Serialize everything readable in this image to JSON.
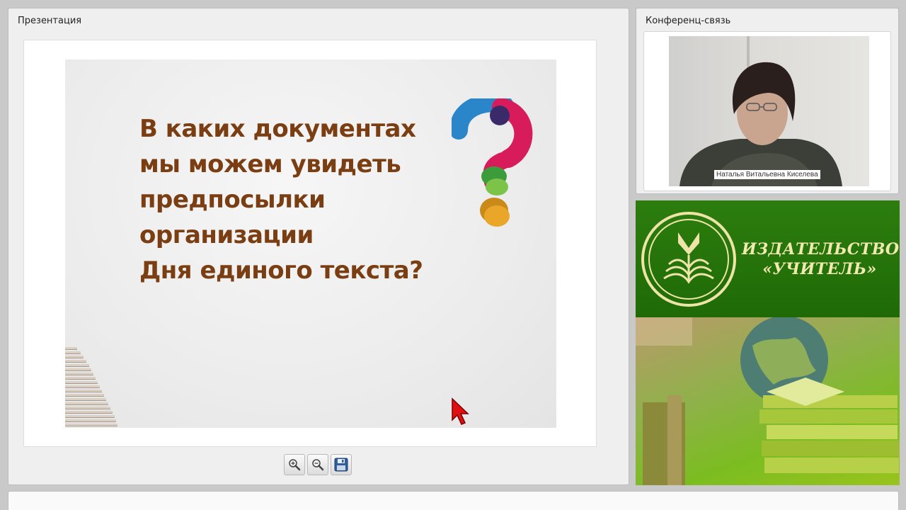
{
  "presentation": {
    "title": "Презентация",
    "slide": {
      "lines": [
        "В каких документах",
        "мы можем увидеть",
        "предпосылки",
        "организации",
        "Дня единого текста?"
      ]
    },
    "toolbar": {
      "zoom_in_icon": "zoom-in-icon",
      "zoom_out_icon": "zoom-out-icon",
      "save_icon": "save-icon"
    }
  },
  "conference": {
    "title": "Конференц-связь",
    "speaker_name": "Наталья Витальевна Киселева"
  },
  "banner": {
    "publisher_line1": "ИЗДАТЕЛЬСТВО",
    "publisher_line2": "«УЧИТЕЛЬ»",
    "brand_green": "#2c7d0e",
    "brand_gold": "#f2e9b0"
  },
  "colors": {
    "slide_text": "#7a3e12",
    "panel_bg": "#efefef",
    "page_bg": "#c9c9c9"
  }
}
